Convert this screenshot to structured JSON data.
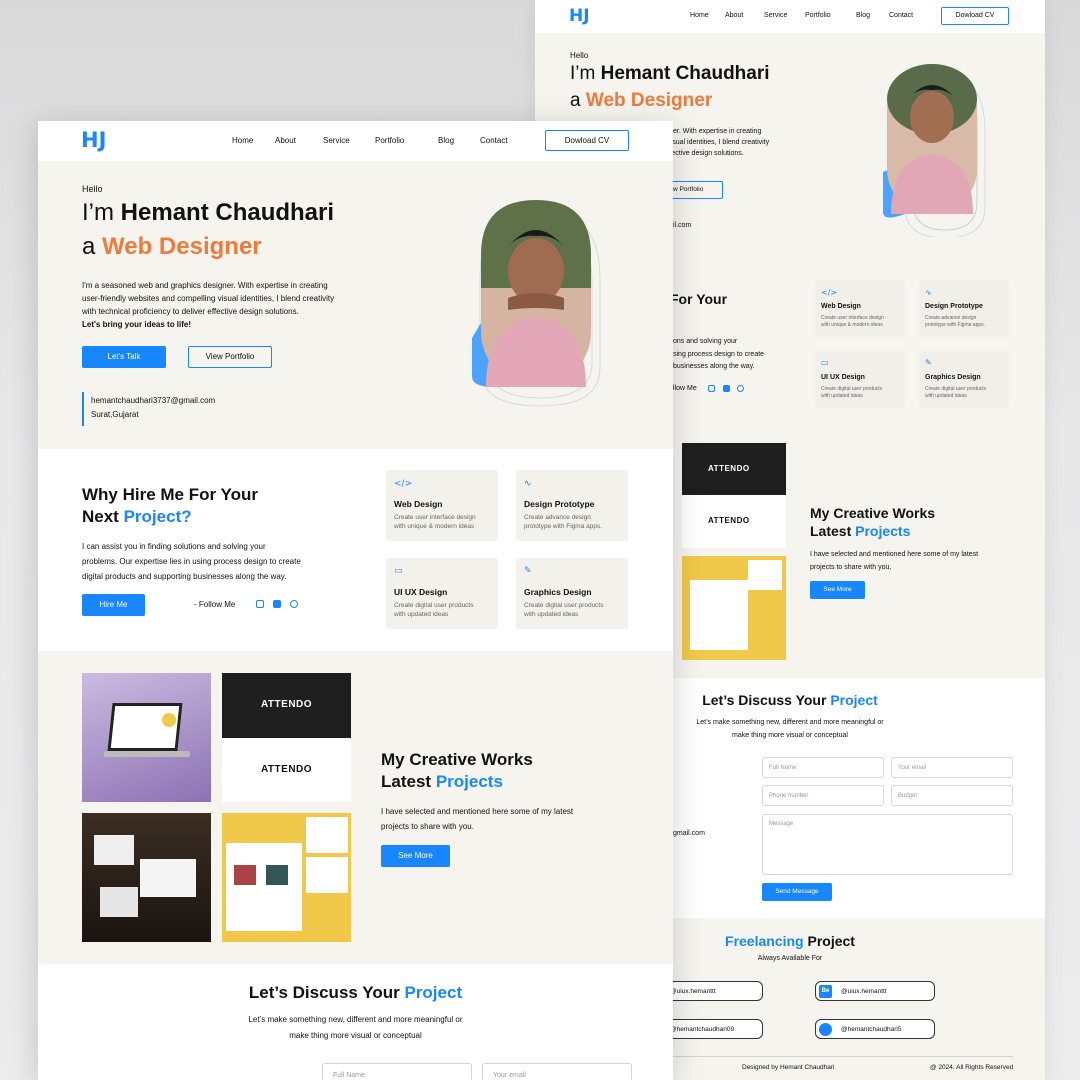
{
  "brand": {
    "logo": "HJ",
    "accent": "#1786ff",
    "orange": "#f07a3c"
  },
  "nav": {
    "home": "Home",
    "about": "About",
    "service": "Service",
    "portfolio": "Portfolio",
    "blog": "Blog",
    "contact": "Contact",
    "cv": "Dowload CV"
  },
  "hero": {
    "hello": "Hello",
    "im": "I’m",
    "name": "Hemant Chaudhari",
    "a": "a",
    "role": "Web Designer",
    "bio1": "I'm a seasoned web and graphics designer. With expertise in creating",
    "bio2": "user-friendly websites  and compelling visual identities, I blend creativity",
    "bio3": "with technical proficiency to deliver effective design solutions.",
    "bio4": "Let's bring your ideas to life!",
    "lets_talk": "Let's Talk",
    "view_portfolio": "View Portfolio",
    "email": "hemantchaudhari3737@gmail.com",
    "location": "Surat,Gujarat"
  },
  "back_hero": {
    "bio1": "ts designer. With expertise in creating",
    "bio2": "pelling visual identities, I blend creativity",
    "bio3": "eliver effective design solutions.",
    "view_portfolio": "View Portfolio",
    "email": "il.com"
  },
  "why": {
    "t1": "Why Hire Me For Your",
    "t2": "Next",
    "t3": "Project?",
    "p1": "I can assist you in finding solutions and solving your",
    "p2": "problems. Our expertise lies in using process design to create",
    "p3": "digital products and supporting businesses along the way.",
    "hire": "Hire Me",
    "follow": "- Follow Me",
    "back_t": "For Your",
    "back_p1": "ons and solving your",
    "back_p2": "sing process design to create",
    "back_p3": "businesses along the way.",
    "back_follow": "llow Me"
  },
  "services": [
    {
      "icon": "code-icon",
      "title": "Web Design",
      "d1": "Create user interface design",
      "d2": "with unique & modern ideas"
    },
    {
      "icon": "pulse-icon",
      "title": "Design Prototype",
      "d1": "Create advance design",
      "d2": "prototype with Figma apps."
    },
    {
      "icon": "monitor-icon",
      "title": "UI UX Design",
      "d1": "Create digital user products",
      "d2": "with updated ideas"
    },
    {
      "icon": "pen-icon",
      "title": "Graphics Design",
      "d1": "Create digital user products",
      "d2": "with updated ideas"
    }
  ],
  "works": {
    "t1": "My Creative Works",
    "t2": "Latest",
    "t3": "Projects",
    "p1": "I have selected and mentioned here some of my latest",
    "p2": "projects to share with you.",
    "see": "See More",
    "attendo": "ATTENDO"
  },
  "discuss": {
    "t1": "Let’s Discuss Your",
    "t2": "Project",
    "p1": "Let’s make something new, different and more meaningful or",
    "p2": "make thing more visual or conceptual",
    "full_name": "Full Name",
    "email": "Your email",
    "phone": "Phone number",
    "budget": "Budget",
    "message": "Message",
    "send": "Send Message",
    "side_email": "gmail.com"
  },
  "freelance": {
    "t1": "Freelancing",
    "t2": "Project",
    "sub": "Always Available For",
    "chips": [
      "@uiux.hemanttt",
      "@uiux.hemanttt",
      "@hemantchaudhari09",
      "@hemantchaudhari5"
    ],
    "be": "Be"
  },
  "footer": {
    "left": "Designed by Hemant Chaudhari",
    "right": "@ 2024. All Rights Reserved"
  }
}
